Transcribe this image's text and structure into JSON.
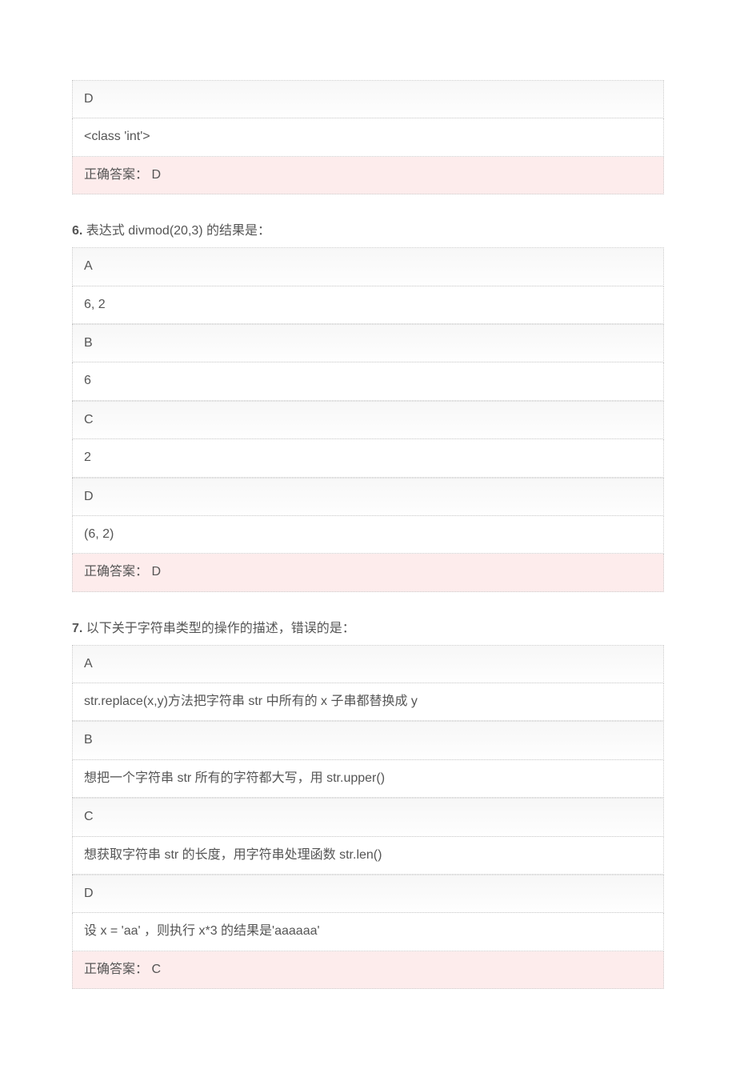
{
  "q5": {
    "optD": "D",
    "optD_text": "<class 'int'>",
    "answer_label": "正确答案：",
    "answer_value": "D"
  },
  "q6": {
    "number": "6.",
    "question": " 表达式  divmod(20,3)  的结果是：",
    "optA": "A",
    "optA_text": "6, 2",
    "optB": "B",
    "optB_text": "6",
    "optC": "C",
    "optC_text": "2",
    "optD": "D",
    "optD_text": "(6, 2)",
    "answer_label": "正确答案：",
    "answer_value": "D"
  },
  "q7": {
    "number": "7.",
    "question": " 以下关于字符串类型的操作的描述，错误的是：",
    "optA": "A",
    "optA_text": "str.replace(x,y)方法把字符串 str 中所有的 x 子串都替换成 y",
    "optB": "B",
    "optB_text": "想把一个字符串 str 所有的字符都大写，用 str.upper()",
    "optC": "C",
    "optC_text": "想获取字符串 str 的长度，用字符串处理函数  str.len()",
    "optD": "D",
    "optD_text": "设  x = 'aa'  ，则执行 x*3 的结果是'aaaaaa'",
    "answer_label": "正确答案：",
    "answer_value": "C"
  }
}
